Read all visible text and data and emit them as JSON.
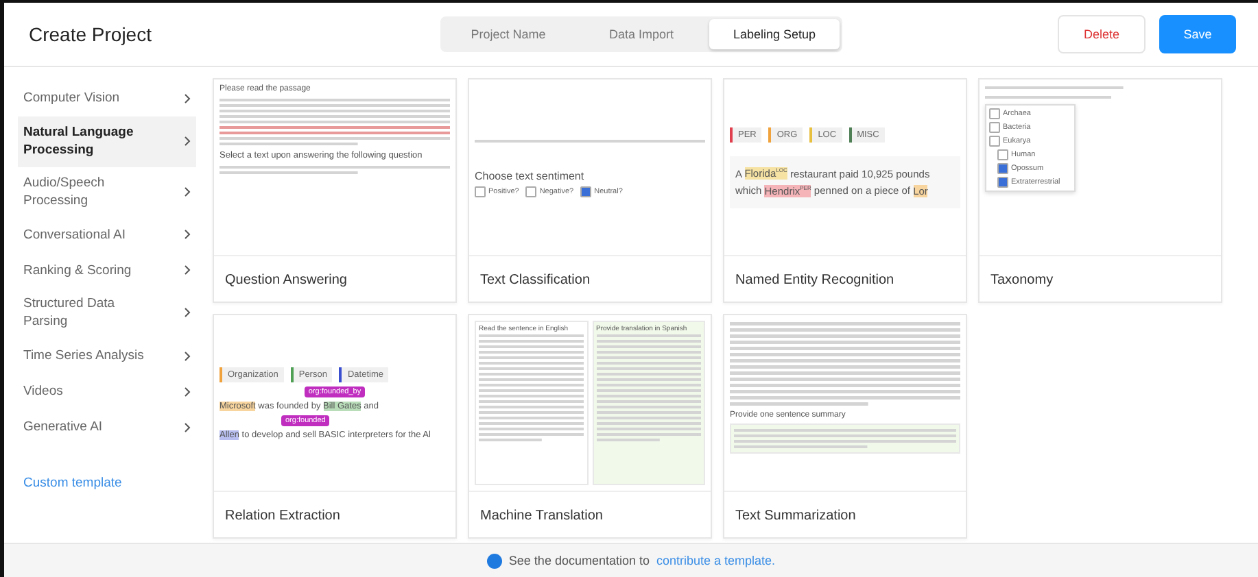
{
  "header": {
    "title": "Create Project",
    "steps": [
      {
        "label": "Project Name",
        "selected": false
      },
      {
        "label": "Data Import",
        "selected": false
      },
      {
        "label": "Labeling Setup",
        "selected": true
      }
    ],
    "buttons": [
      {
        "label": "Delete",
        "kind": "secondary"
      },
      {
        "label": "Save",
        "kind": "primary"
      }
    ]
  },
  "sidebar": {
    "items": [
      {
        "label": "Computer Vision",
        "selected": false
      },
      {
        "label": "Natural Language Processing",
        "selected": true
      },
      {
        "label": "Audio/Speech Processing",
        "selected": false
      },
      {
        "label": "Conversational AI",
        "selected": false
      },
      {
        "label": "Ranking & Scoring",
        "selected": false
      },
      {
        "label": "Structured Data Parsing",
        "selected": false
      },
      {
        "label": "Time Series Analysis",
        "selected": false
      },
      {
        "label": "Videos",
        "selected": false
      },
      {
        "label": "Generative AI",
        "selected": false
      }
    ],
    "custom_link": "Custom template"
  },
  "templates": [
    {
      "kind": "qa",
      "title": "Question Answering",
      "heading": "Please read the passage",
      "prompt": "Select a text upon answering the following question"
    },
    {
      "kind": "classification",
      "title": "Text Classification",
      "prompt": "Choose text sentiment",
      "options": [
        {
          "label": "Positive?",
          "checked": false
        },
        {
          "label": "Negative?",
          "checked": false
        },
        {
          "label": "Neutral?",
          "checked": true
        }
      ]
    },
    {
      "kind": "ner",
      "title": "Named Entity Recognition",
      "labels": [
        {
          "label": "PER",
          "color": "#e0404e"
        },
        {
          "label": "ORG",
          "color": "#f0a23c"
        },
        {
          "label": "LOC",
          "color": "#e8c040"
        },
        {
          "label": "MISC",
          "color": "#4f7f55"
        }
      ],
      "lines": [
        [
          {
            "text": "A "
          },
          {
            "text": "Florida",
            "tag": "LOC",
            "color": "#f6e2a2"
          },
          {
            "text": " restaurant paid 10,925 pounds"
          }
        ],
        [
          {
            "text": "which "
          },
          {
            "text": "Hendrix",
            "tag": "PER",
            "color": "#f4b4b8"
          },
          {
            "text": " penned on a piece of "
          },
          {
            "text": "Lor",
            "color": "#f8d59e"
          }
        ]
      ]
    },
    {
      "kind": "taxonomy",
      "title": "Taxonomy",
      "options": [
        {
          "label": "Archaea",
          "checked": false
        },
        {
          "label": "Bacteria",
          "checked": false
        },
        {
          "label": "Eukarya",
          "checked": false
        },
        {
          "label": "Human",
          "checked": false
        },
        {
          "label": "Opossum",
          "checked": true
        },
        {
          "label": "Extraterrestrial",
          "checked": true
        }
      ]
    },
    {
      "kind": "relation",
      "title": "Relation Extraction",
      "labels": [
        {
          "label": "Organization",
          "color": "#f0a23c"
        },
        {
          "label": "Person",
          "color": "#4f9f55"
        },
        {
          "label": "Datetime",
          "color": "#3a4fd0"
        }
      ],
      "relations": [
        "org:founded_by",
        "org:founded"
      ],
      "lines": [
        [
          {
            "text": "Microsoft",
            "color": "#f8d59e"
          },
          {
            "text": " was founded by "
          },
          {
            "text": "Bill Gates",
            "color": "#b9dcb9"
          },
          {
            "text": " and"
          }
        ],
        [
          {
            "text": "Allen",
            "color": "#b8bff0"
          },
          {
            "text": " to develop and sell BASIC interpreters for the Al"
          }
        ]
      ]
    },
    {
      "kind": "translation",
      "title": "Machine Translation",
      "source_heading": "Read the sentence in English",
      "target_heading": "Provide translation in Spanish"
    },
    {
      "kind": "summarization",
      "title": "Text Summarization",
      "prompt": "Provide one sentence summary"
    }
  ],
  "footer": {
    "text": "See the documentation to",
    "link": "contribute a template."
  }
}
